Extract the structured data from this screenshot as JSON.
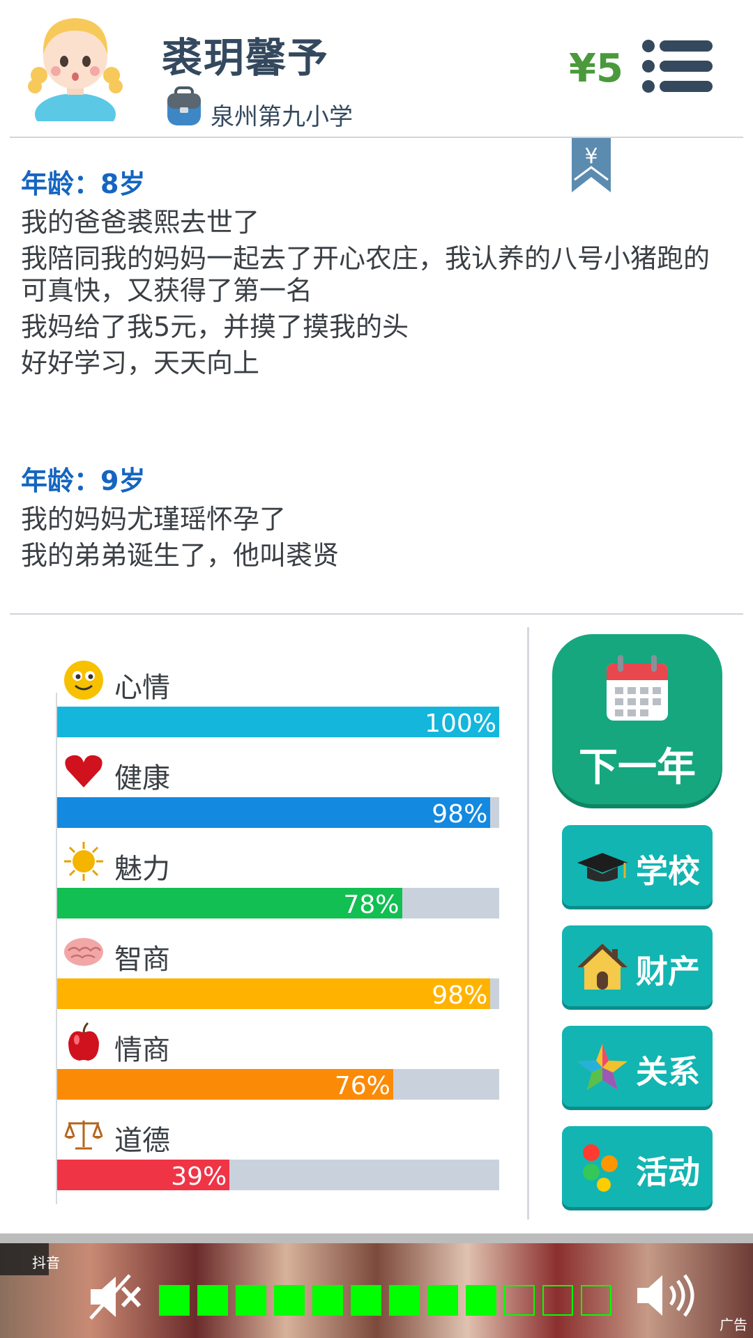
{
  "profile": {
    "name": "裘玥馨予",
    "school": "泉州第九小学",
    "money": "¥5"
  },
  "bookmark_symbol": "¥",
  "log": [
    {
      "age": "年龄：8岁",
      "lines": [
        "我的爸爸裘熙去世了",
        "我陪同我的妈妈一起去了开心农庄，我认养的八号小猪跑的可真快，又获得了第一名",
        "我妈给了我5元，并摸了摸我的头",
        "好好学习，天天向上"
      ]
    },
    {
      "age": "年龄：9岁",
      "lines": [
        "我的妈妈尤瑾瑶怀孕了",
        "我的弟弟诞生了，他叫裘贤"
      ]
    }
  ],
  "stats": [
    {
      "label": "心情",
      "value": 100,
      "text": "100%",
      "color": "#14b6db",
      "icon": "smiley-icon"
    },
    {
      "label": "健康",
      "value": 98,
      "text": "98%",
      "color": "#1389e0",
      "icon": "heart-icon"
    },
    {
      "label": "魅力",
      "value": 78,
      "text": "78%",
      "color": "#12bf52",
      "icon": "sun-icon"
    },
    {
      "label": "智商",
      "value": 98,
      "text": "98%",
      "color": "#ffb300",
      "icon": "brain-icon"
    },
    {
      "label": "情商",
      "value": 76,
      "text": "76%",
      "color": "#fb8b07",
      "icon": "apple-icon"
    },
    {
      "label": "道德",
      "value": 39,
      "text": "39%",
      "color": "#ef3446",
      "icon": "scales-icon"
    }
  ],
  "actions": {
    "next_year": "下一年",
    "school": "学校",
    "property": "财产",
    "relations": "关系",
    "activities": "活动"
  },
  "ad": {
    "app": "抖音",
    "tag": "广告",
    "volume_level": 9,
    "volume_max": 12
  },
  "colors": {
    "title": "#34495e",
    "age": "#1565c0",
    "money": "#4a9a3c",
    "next_year": "#16a77f",
    "side_button": "#12b5b2"
  }
}
